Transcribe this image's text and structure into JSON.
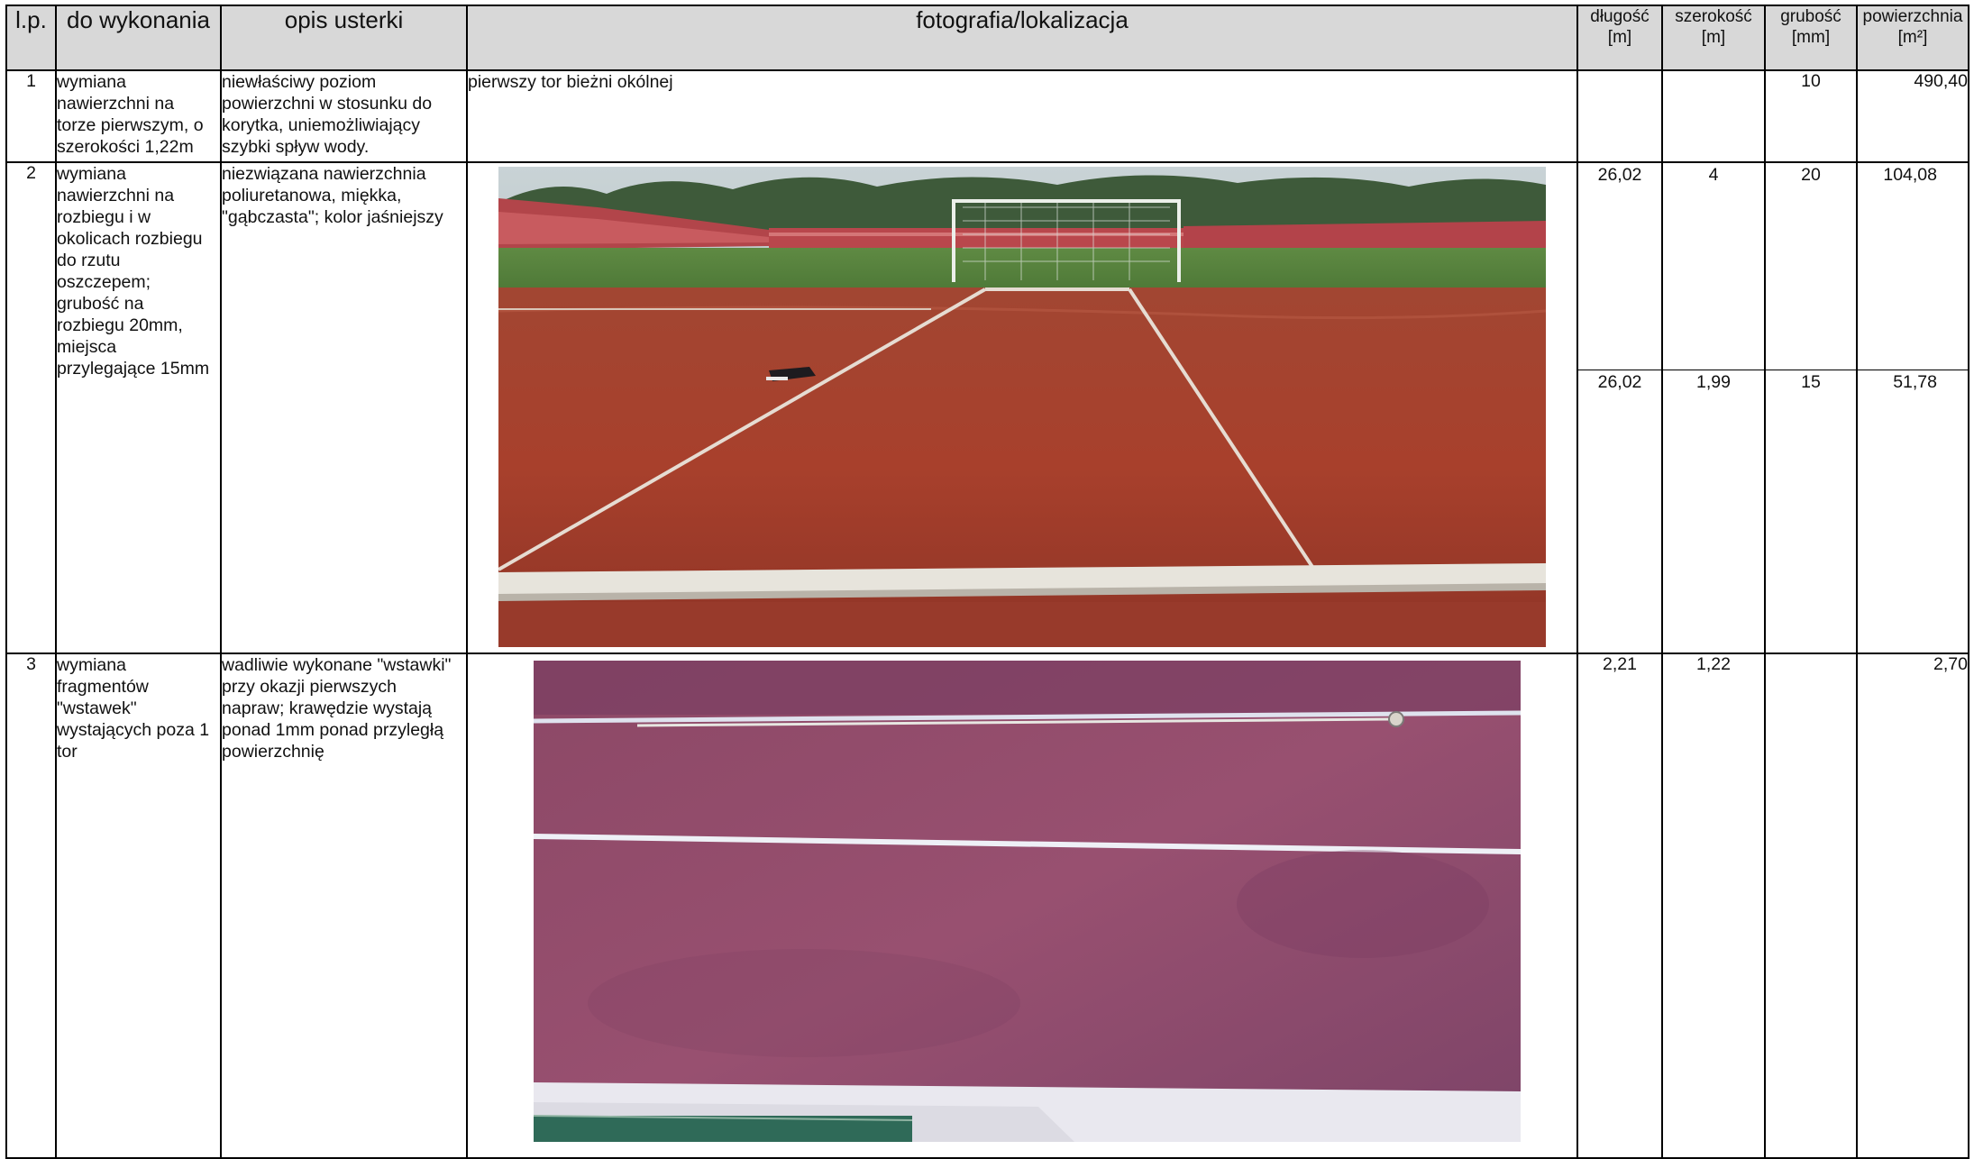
{
  "headers": {
    "lp": "l.p.",
    "do_wykonania": "do wykonania",
    "opis": "opis usterki",
    "foto": "fotografia/lokalizacja",
    "dlugosc": [
      "długość",
      "[m]"
    ],
    "szerokosc": [
      "szerokość",
      "[m]"
    ],
    "grubosc": [
      "grubość",
      "[mm]"
    ],
    "powierzchnia": [
      "powierzchnia",
      "[m²]"
    ]
  },
  "rows": [
    {
      "lp": "1",
      "do_wykonania": [
        "wymiana",
        "nawierzchni na",
        "torze pierwszym, o",
        "szerokości 1,22m"
      ],
      "opis": [
        "niewłaściwy poziom",
        "powierzchni w stosunku do",
        "korytka, uniemożliwiający",
        "szybki spływ wody."
      ],
      "lokalizacja": "pierwszy tor bieżni okólnej",
      "dlugosc": "",
      "szerokosc": "",
      "grubosc": "10",
      "powierzchnia": "490,40"
    },
    {
      "lp": "2",
      "do_wykonania": [
        "wymiana",
        "nawierzchni na",
        "rozbiegu i w",
        "okolicach rozbiegu",
        "do rzutu",
        "oszczepem;",
        "grubość na",
        "rozbiegu 20mm,",
        "miejsca",
        "przylegające 15mm"
      ],
      "opis": [
        "niezwiązana nawierzchnia",
        "poliuretanowa, miękka,",
        "\"gąbczasta\"; kolor jaśniejszy"
      ],
      "photo": "photo-stadium-javelin-runway",
      "sub": [
        {
          "dlugosc": "26,02",
          "szerokosc": "4",
          "grubosc": "20",
          "powierzchnia": "104,08"
        },
        {
          "dlugosc": "26,02",
          "szerokosc": "1,99",
          "grubosc": "15",
          "powierzchnia": "51,78"
        }
      ]
    },
    {
      "lp": "3",
      "do_wykonania": [
        "wymiana",
        "fragmentów",
        "\"wstawek\"",
        "wystających poza 1",
        "tor"
      ],
      "opis": [
        "wadliwie wykonane \"wstawki\"",
        "przy okazji pierwszych",
        "napraw; krawędzie wystają",
        "ponad 1mm ponad przyległą",
        "powierzchnię"
      ],
      "photo": "photo-track-lane-inserts",
      "dlugosc": "2,21",
      "szerokosc": "1,22",
      "grubosc": "",
      "powierzchnia": "2,70"
    }
  ]
}
